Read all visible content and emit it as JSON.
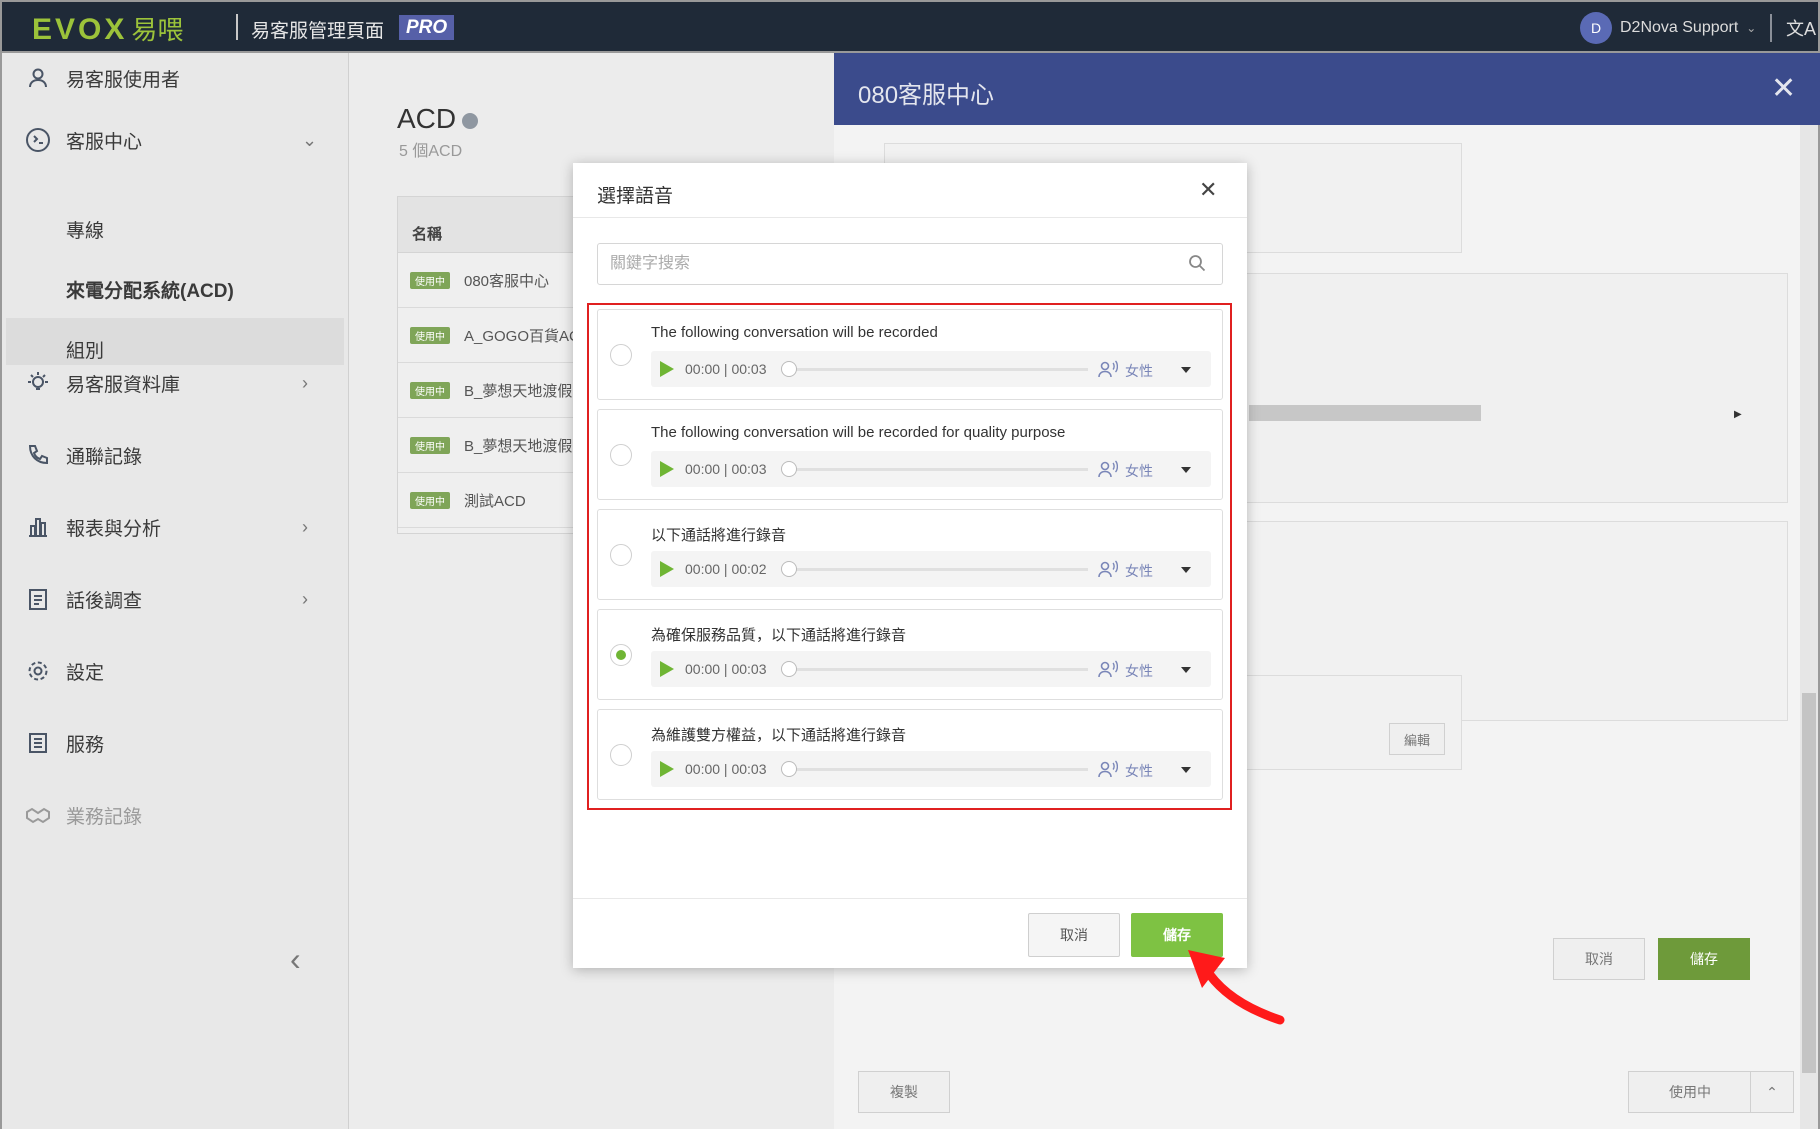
{
  "topbar": {
    "logo": "EVOX",
    "logo_cn": "易喂",
    "title": "易客服管理頁面",
    "badge": "PRO",
    "user_initial": "D",
    "user_name": "D2Nova Support",
    "lang_icon": "translate-icon"
  },
  "sidebar": {
    "items": [
      {
        "label": "易客服使用者",
        "icon": "user-icon"
      },
      {
        "label": "客服中心",
        "icon": "headset-icon"
      },
      {
        "label": "專線"
      },
      {
        "label": "來電分配系統(ACD)"
      },
      {
        "label": "組別"
      },
      {
        "label": "易客服資料庫",
        "icon": "lightbulb-icon"
      },
      {
        "label": "通聯記錄",
        "icon": "phone-log-icon"
      },
      {
        "label": "報表與分析",
        "icon": "bar-chart-icon"
      },
      {
        "label": "話後調查",
        "icon": "survey-icon"
      },
      {
        "label": "設定",
        "icon": "gear-icon"
      },
      {
        "label": "服務",
        "icon": "list-icon"
      },
      {
        "label": "業務記錄",
        "icon": "handshake-icon"
      }
    ]
  },
  "main": {
    "title": "ACD",
    "subtitle": "5 個ACD",
    "column_name": "名稱",
    "status_tag": "使用中",
    "rows": [
      "080客服中心",
      "A_GOGO百貨AC",
      "B_夢想天地渡假",
      "B_夢想天地渡假",
      "測試ACD"
    ]
  },
  "drawer": {
    "title": "080客服中心",
    "edit_label": "編輯",
    "cancel_label": "取消",
    "save_label": "儲存",
    "copy_label": "複製",
    "status_label": "使用中"
  },
  "modal": {
    "title": "選擇語音",
    "search_placeholder": "關鍵字搜索",
    "items": [
      {
        "title": "The following conversation will be recorded",
        "time": "00:00 | 00:03",
        "voice": "女性",
        "selected": false
      },
      {
        "title": "The following conversation will be recorded for quality purpose",
        "time": "00:00 | 00:03",
        "voice": "女性",
        "selected": false
      },
      {
        "title": "以下通話將進行錄音",
        "time": "00:00 | 00:02",
        "voice": "女性",
        "selected": false
      },
      {
        "title": "為確保服務品質，以下通話將進行錄音",
        "time": "00:00 | 00:03",
        "voice": "女性",
        "selected": true
      },
      {
        "title": "為維護雙方權益，以下通話將進行錄音",
        "time": "00:00 | 00:03",
        "voice": "女性",
        "selected": false
      }
    ],
    "cancel_label": "取消",
    "save_label": "儲存"
  },
  "colors": {
    "accent_green": "#7ec243",
    "header_blue": "#3b4b8c",
    "topbar": "#1f2a38",
    "highlight_red": "#e02020"
  }
}
